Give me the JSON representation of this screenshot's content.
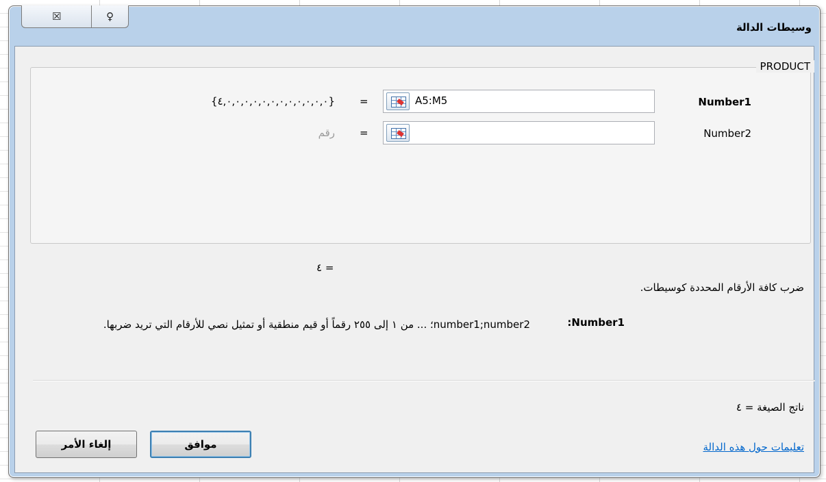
{
  "window": {
    "title": "وسيطات الدالة",
    "close_glyph": "☒",
    "help_glyph": "♀"
  },
  "function_group": {
    "name": "PRODUCT",
    "arguments": [
      {
        "label": "Number1",
        "input_value": "A5:M5",
        "evaluated": "{٤,٠,٠,٠,٠,٠,٠,٠,٠,٠,٠,٠,٠}",
        "equals": "="
      },
      {
        "label": "Number2",
        "input_value": "",
        "evaluated": "رقم",
        "equals": "="
      }
    ]
  },
  "result_line": "= ٤",
  "description": "ضرب كافة الأرقام المحددة كوسيطات.",
  "arg_help": {
    "name": ":Number1",
    "text": "number1;number2؛ ... من ١ إلى ٢٥٥ رقماً أو قيم منطقية أو تمثيل نصي للأرقام التي تريد ضربها."
  },
  "formula_result": "ناتج الصيغة = ٤",
  "help_link": "تعليمات حول هذه الدالة",
  "buttons": {
    "ok": "موافق",
    "cancel": "إلغاء الأمر"
  },
  "icons": {
    "ref_button": "range-select-icon"
  }
}
